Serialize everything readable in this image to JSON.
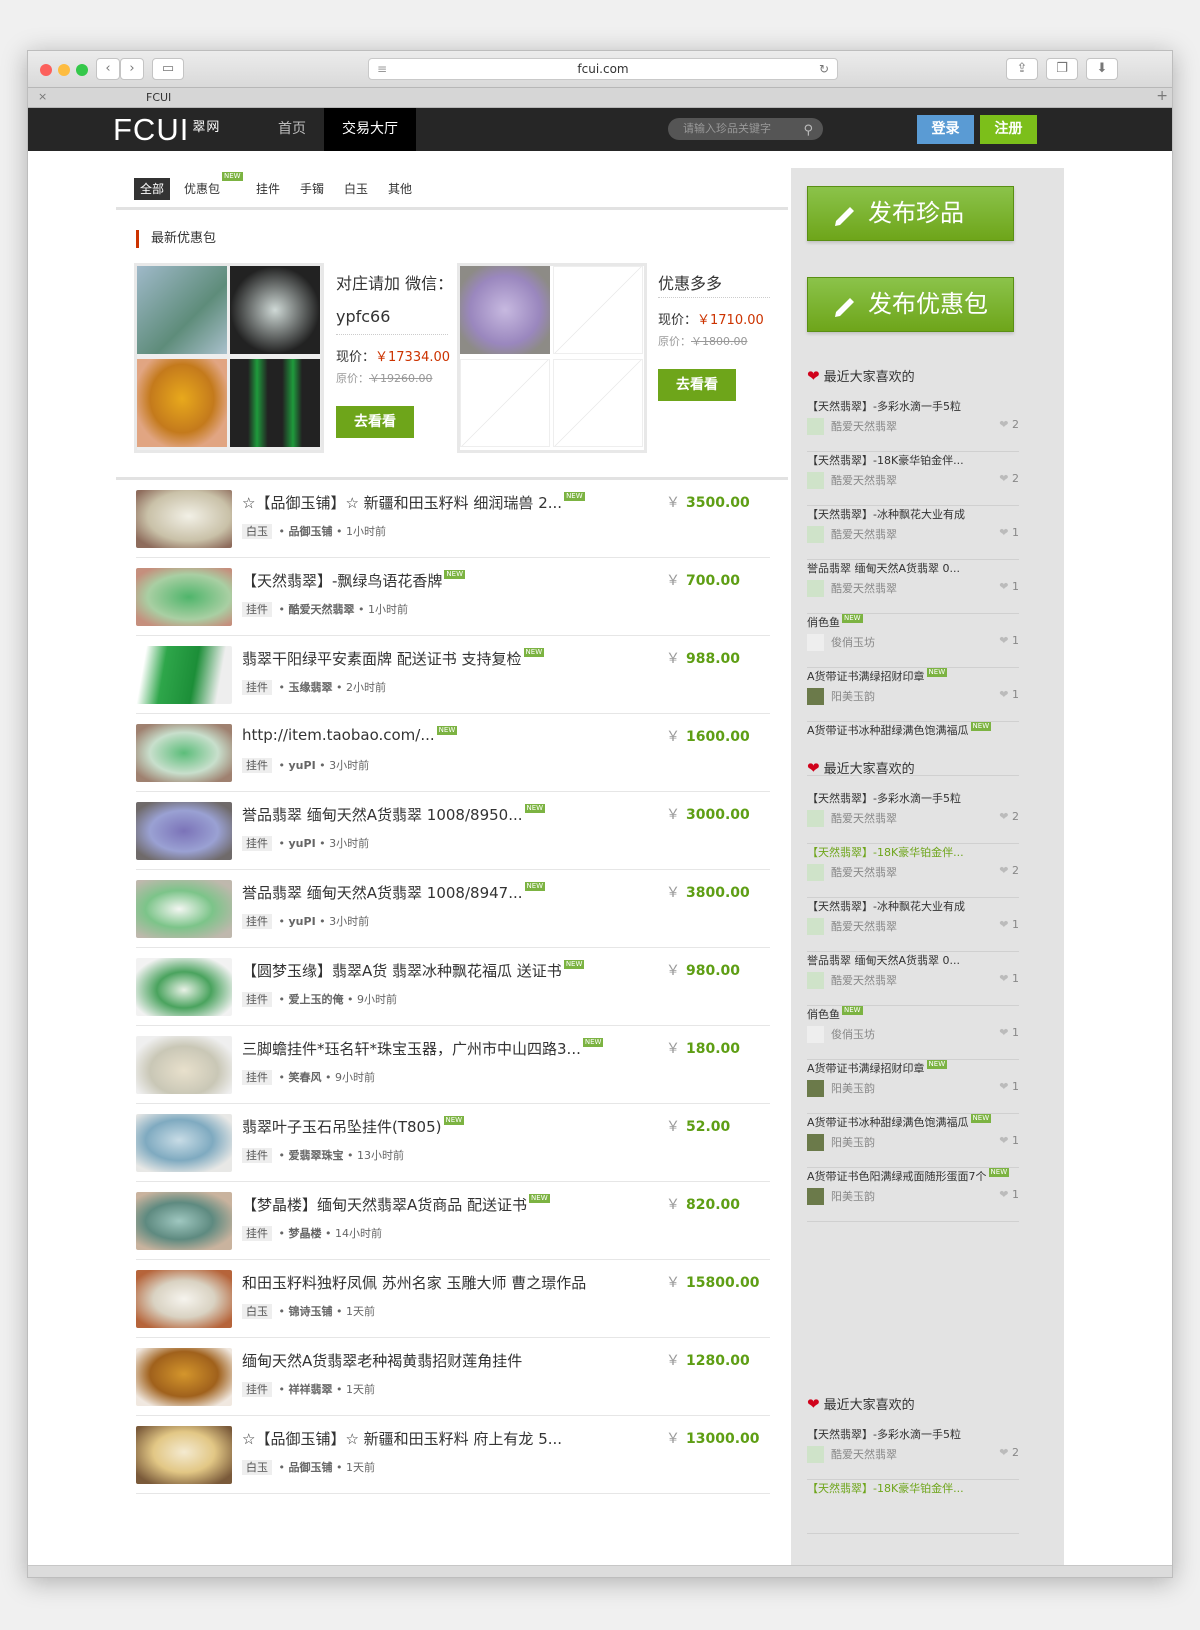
{
  "browser": {
    "url": "fcui.com",
    "tab_title": "FCUI"
  },
  "header": {
    "logo": "FCUI",
    "logo_sub": "翠网",
    "nav": [
      "首页",
      "交易大厅"
    ],
    "search_placeholder": "请输入珍品关键字",
    "login": "登录",
    "register": "注册"
  },
  "filters": [
    "全部",
    "优惠包",
    "挂件",
    "手镯",
    "白玉",
    "其他"
  ],
  "packages": {
    "section_title": "最新优惠包",
    "p1": {
      "title_line1": "对庄请加 微信：",
      "title_line2": "ypfc66",
      "price_label": "现价：",
      "price": "￥17334.00",
      "orig_label": "原价：",
      "orig": "￥19260.00",
      "button": "去看看"
    },
    "p2": {
      "title": "优惠多多",
      "price_label": "现价：",
      "price": "￥1710.00",
      "orig_label": "原价：",
      "orig": "￥1800.00",
      "button": "去看看"
    }
  },
  "products": [
    {
      "title": "☆【品御玉铺】☆ 新疆和田玉籽料 细润瑞兽 2...",
      "cat": "白玉",
      "seller": "品御玉铺",
      "time": "1小时前",
      "price": "3500.00",
      "new": true
    },
    {
      "title": "【天然翡翠】-飘绿鸟语花香牌",
      "cat": "挂件",
      "seller": "酷爱天然翡翠",
      "time": "1小时前",
      "price": "700.00",
      "new": true
    },
    {
      "title": "翡翠干阳绿平安素面牌 配送证书 支持复检",
      "cat": "挂件",
      "seller": "玉缘翡翠",
      "time": "2小时前",
      "price": "988.00",
      "new": true
    },
    {
      "title": "http://item.taobao.com/...",
      "cat": "挂件",
      "seller": "yuPI",
      "time": "3小时前",
      "price": "1600.00",
      "new": true
    },
    {
      "title": "誉品翡翠 缅甸天然A货翡翠 1008/8950...",
      "cat": "挂件",
      "seller": "yuPI",
      "time": "3小时前",
      "price": "3000.00",
      "new": true
    },
    {
      "title": "誉品翡翠 缅甸天然A货翡翠 1008/8947...",
      "cat": "挂件",
      "seller": "yuPI",
      "time": "3小时前",
      "price": "3800.00",
      "new": true
    },
    {
      "title": "【圆梦玉缘】翡翠A货 翡翠冰种飘花福瓜 送证书",
      "cat": "挂件",
      "seller": "爱上玉的俺",
      "time": "9小时前",
      "price": "980.00",
      "new": true
    },
    {
      "title": "三脚蟾挂件*珏名轩*珠宝玉器，广州市中山四路3...",
      "cat": "挂件",
      "seller": "笑春风",
      "time": "9小时前",
      "price": "180.00",
      "new": true
    },
    {
      "title": "翡翠叶子玉石吊坠挂件(T805)",
      "cat": "挂件",
      "seller": "爱翡翠珠宝",
      "time": "13小时前",
      "price": "52.00",
      "new": true
    },
    {
      "title": "【梦晶楼】缅甸天然翡翠A货商品 配送证书",
      "cat": "挂件",
      "seller": "梦晶楼",
      "time": "14小时前",
      "price": "820.00",
      "new": true
    },
    {
      "title": "和田玉籽料独籽凤佩 苏州名家 玉雕大师 曹之璟作品",
      "cat": "白玉",
      "seller": "锦诗玉铺",
      "time": "1天前",
      "price": "15800.00",
      "new": false
    },
    {
      "title": "缅甸天然A货翡翠老种褐黄翡招财莲角挂件",
      "cat": "挂件",
      "seller": "祥祥翡翠",
      "time": "1天前",
      "price": "1280.00",
      "new": false
    },
    {
      "title": "☆【品御玉铺】☆ 新疆和田玉籽料 府上有龙 5...",
      "cat": "白玉",
      "seller": "品御玉铺",
      "time": "1天前",
      "price": "13000.00",
      "new": false
    }
  ],
  "product_meta": {
    "yen": "￥",
    "new_tag": "NEW",
    "dot": "•"
  },
  "sidebar": {
    "btn_publish": "发布珍品",
    "btn_package": "发布优惠包",
    "heading": "最近大家喜欢的",
    "list1": [
      {
        "title": "【天然翡翠】-多彩水滴一手5粒",
        "user": "酷爱天然翡翠",
        "likes": "2",
        "new": false,
        "green": false
      },
      {
        "title": "【天然翡翠】-18K豪华铂金伴...",
        "user": "酷爱天然翡翠",
        "likes": "2",
        "new": false,
        "green": false
      },
      {
        "title": "【天然翡翠】-冰种飘花大业有成",
        "user": "酷爱天然翡翠",
        "likes": "1",
        "new": false,
        "green": false
      },
      {
        "title": "誉品翡翠 缅甸天然A货翡翠 0...",
        "user": "酷爱天然翡翠",
        "likes": "1",
        "new": false,
        "green": false
      },
      {
        "title": "俏色鱼",
        "user": "俊俏玉坊",
        "likes": "1",
        "new": true,
        "green": false
      },
      {
        "title": "A货带证书满绿招财印章",
        "user": "阳美玉韵",
        "likes": "1",
        "new": true,
        "green": false
      },
      {
        "title": "A货带证书冰种甜绿满色饱满福瓜",
        "user": "",
        "likes": "",
        "new": true,
        "green": false
      }
    ],
    "list2": [
      {
        "title": "【天然翡翠】-多彩水滴一手5粒",
        "user": "酷爱天然翡翠",
        "likes": "2",
        "new": false,
        "green": false
      },
      {
        "title": "【天然翡翠】-18K豪华铂金伴...",
        "user": "酷爱天然翡翠",
        "likes": "2",
        "new": false,
        "green": true
      },
      {
        "title": "【天然翡翠】-冰种飘花大业有成",
        "user": "酷爱天然翡翠",
        "likes": "1",
        "new": false,
        "green": false
      },
      {
        "title": "誉品翡翠 缅甸天然A货翡翠 0...",
        "user": "酷爱天然翡翠",
        "likes": "1",
        "new": false,
        "green": false
      },
      {
        "title": "俏色鱼",
        "user": "俊俏玉坊",
        "likes": "1",
        "new": true,
        "green": false
      },
      {
        "title": "A货带证书满绿招财印章",
        "user": "阳美玉韵",
        "likes": "1",
        "new": true,
        "green": false
      },
      {
        "title": "A货带证书冰种甜绿满色饱满福瓜",
        "user": "阳美玉韵",
        "likes": "1",
        "new": true,
        "green": false
      },
      {
        "title": "A货带证书色阳满绿戒面随形蛋面7个",
        "user": "阳美玉韵",
        "likes": "1",
        "new": true,
        "green": false
      }
    ],
    "list3": [
      {
        "title": "【天然翡翠】-多彩水滴一手5粒",
        "user": "酷爱天然翡翠",
        "likes": "2",
        "new": false,
        "green": false
      },
      {
        "title": "【天然翡翠】-18K豪华铂金伴...",
        "user": "",
        "likes": "",
        "new": false,
        "green": true
      }
    ]
  },
  "colors": {
    "accent_green": "#6ea51a",
    "price_red": "#cc3300",
    "header_bg": "#262626",
    "login_blue": "#5a9bd4",
    "register_green": "#7cbf1a"
  }
}
